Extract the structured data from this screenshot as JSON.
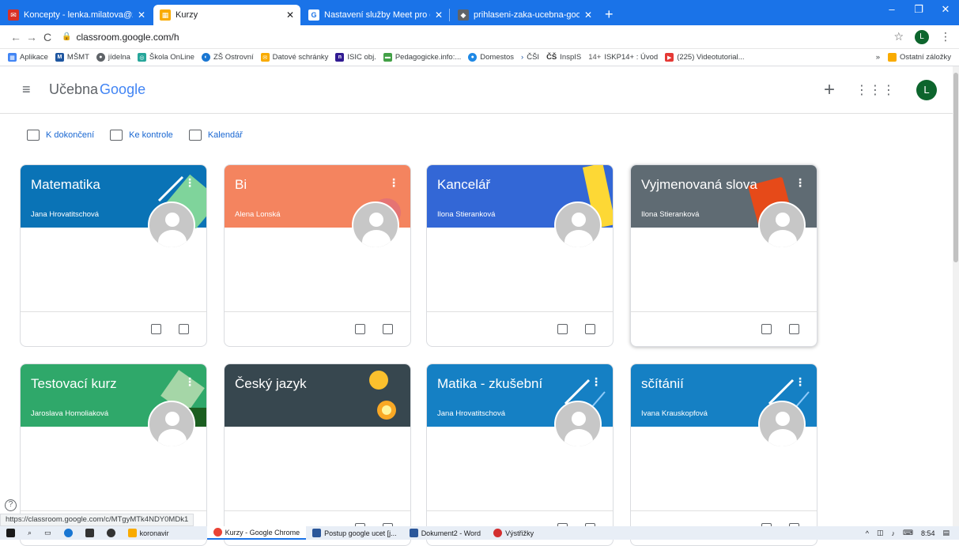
{
  "browser": {
    "tabs": [
      {
        "title": "Koncepty - lenka.milatova@zsste",
        "favicon_color": "#d93025",
        "active": false
      },
      {
        "title": "Kurzy",
        "favicon_color": "#f9ab00",
        "active": true
      },
      {
        "title": "Nastavení služby Meet pro distan",
        "favicon_color": "#1a73e8",
        "active": false
      },
      {
        "title": "prihlaseni-zaka-ucebna-google-",
        "favicon_color": "#5f6368",
        "active": false
      }
    ],
    "url": "classroom.google.com/h",
    "profile_initial": "L",
    "bookmarks": [
      "Aplikace",
      "MŠMT",
      "jídelna",
      "Škola OnLine",
      "ZŠ Ostrovní",
      "Datové schránky",
      "ISIC obj.",
      "Pedagogicke.info:...",
      "Domestos",
      "ČŠI",
      "InspIS",
      "ISKP14+ : Úvod",
      "(225) Videotutorial..."
    ],
    "bookmarks_more": "»",
    "other_bookmarks": "Ostatní záložky"
  },
  "classroom": {
    "brand_prefix": "Učebna",
    "brand_google": "Google",
    "avatar_initial": "L",
    "quicklinks": [
      "K dokončení",
      "Ke kontrole",
      "Kalendář"
    ]
  },
  "courses": [
    {
      "title": "Matematika",
      "teacher": "Jana Hrovatitschová",
      "color": "#0a73b6"
    },
    {
      "title": "Bi",
      "teacher": "Alena Lonská",
      "color": "#f4845f"
    },
    {
      "title": "Kancelář",
      "teacher": "Ilona Stieranková",
      "color": "#3367d6"
    },
    {
      "title": "Vyjmenovaná slova",
      "teacher": "Ilona Stieranková",
      "color": "#5f6b73"
    },
    {
      "title": "Testovací kurz",
      "teacher": "Jaroslava Homoliaková",
      "color": "#2fa86a"
    },
    {
      "title": "Český jazyk",
      "teacher": "",
      "color": "#37474f"
    },
    {
      "title": "Matika - zkušební",
      "teacher": "Jana Hrovatitschová",
      "color": "#1580c4"
    },
    {
      "title": "sčítánií",
      "teacher": "Ivana Krauskopfová",
      "color": "#1580c4"
    }
  ],
  "status_url": "https://classroom.google.com/c/MTgyMTk4NDY0MDk1",
  "taskbar": {
    "items": [
      "koronavir",
      "Kurzy - Google Chrome",
      "Postup google ucet [j...",
      "Dokument2 - Word",
      "Výstřižky"
    ],
    "time": "8:54"
  }
}
